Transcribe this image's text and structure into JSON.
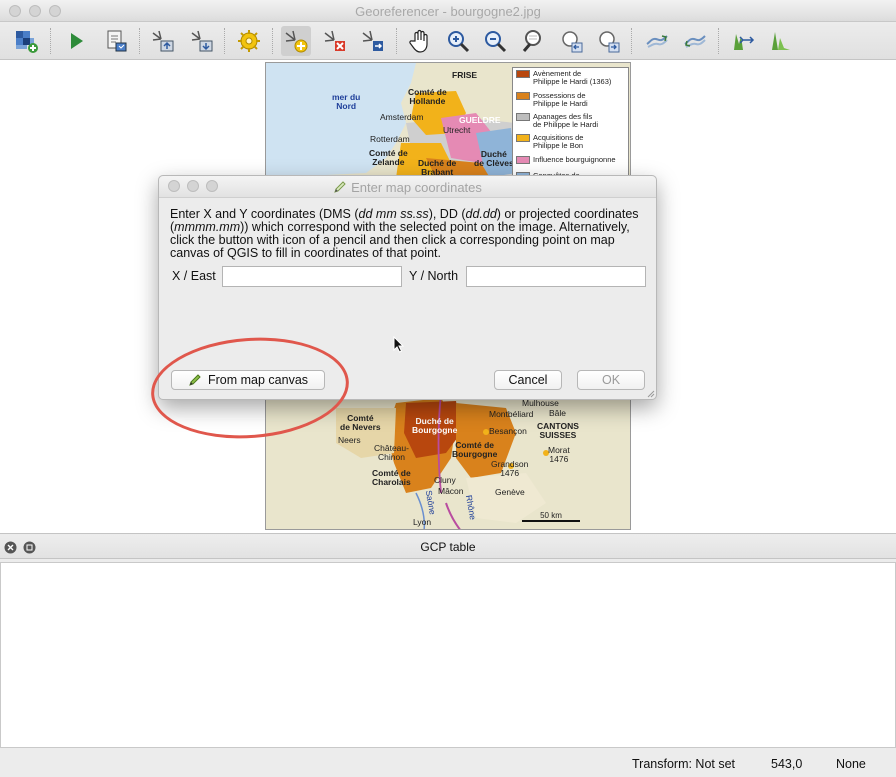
{
  "window": {
    "title": "Georeferencer - bourgogne2.jpg"
  },
  "toolbar": {
    "icons": [
      "open-raster-icon",
      "start-georeferencing-icon",
      "generate-gdal-script-icon",
      "load-gcp-points-icon",
      "save-gcp-points-icon",
      "transformation-settings-icon",
      "add-point-icon",
      "delete-point-icon",
      "move-gcp-point-icon",
      "pan-icon",
      "zoom-in-icon",
      "zoom-out-icon",
      "zoom-to-layer-icon",
      "zoom-last-icon",
      "zoom-next-icon",
      "link-georeferencer-to-qgis-icon",
      "link-qgis-to-georeferencer-icon",
      "full-histogram-stretch-icon",
      "local-histogram-stretch-icon"
    ]
  },
  "map": {
    "labels": {
      "sea": "mer du\nNord",
      "frise": "FRISE",
      "hollande": "Comté de\nHollande",
      "amsterdam": "Amsterdam",
      "gueldre": "GUELDRE",
      "utrecht": "Utrecht",
      "rotterdam": "Rotterdam",
      "zelande": "Comté de\nZelande",
      "brabant": "Duché de\nBrabant",
      "cleves": "Duché\nde Clèves",
      "nevers": "Comté\nde Nevers",
      "neers": "Neers",
      "chinon": "Château-\nChinon",
      "charolais": "Comté de\nCharolais",
      "duchebourgogne": "Duché de\nBourgogne",
      "comtebourgogne": "Comté de\nBourgogne",
      "montbeliard": "Montbéliard",
      "mulhouse": "Mulhouse",
      "bale": "Bâle",
      "besancon": "Besançon",
      "cantons": "CANTONS\nSUISSES",
      "morat": "Morat\n1476",
      "grandson": "Grandson\n1476",
      "cluny": "Cluny",
      "macon": "Mâcon",
      "geneve": "Genève",
      "lyon": "Lyon",
      "saone": "Saône",
      "rhone": "Rhône",
      "scale": "50 km"
    },
    "legend": [
      {
        "label": "Avènement de\nPhilippe le Hardi (1363)",
        "color": "#b8470e"
      },
      {
        "label": "Possessions de\nPhilippe le Hardi",
        "color": "#d9821c"
      },
      {
        "label": "Apanages des fils\nde Philippe le Hardi",
        "color": "#bdbdbd"
      },
      {
        "label": "Acquisitions de\nPhilippe le Bon",
        "color": "#f2b21a"
      },
      {
        "label": "Influence bourguignonne",
        "color": "#e58ab4"
      },
      {
        "label": "Conquêtes de",
        "color": "#8fb4d8"
      }
    ]
  },
  "dialog": {
    "title": "Enter map coordinates",
    "text": {
      "p1": "Enter X and Y coordinates (DMS (",
      "dms": "dd mm ss.ss",
      "p2": "), DD (",
      "dd": "dd.dd",
      "p3": ") or projected coordinates (",
      "proj": "mmmm.mm",
      "p4": ")) which correspond with the selected point on the image. Alternatively, click the button with icon of a pencil and then click a corresponding point on map canvas of QGIS to fill in coordinates of that point."
    },
    "x_label": "X / East",
    "x_value": "",
    "y_label": "Y / North",
    "y_value": "",
    "from_canvas": "From map canvas",
    "cancel": "Cancel",
    "ok": "OK",
    "highlight_color": "#e0574c"
  },
  "gcp": {
    "title": "GCP table"
  },
  "status": {
    "transform": "Transform: Not set",
    "coords": "543,0",
    "crs": "None"
  }
}
